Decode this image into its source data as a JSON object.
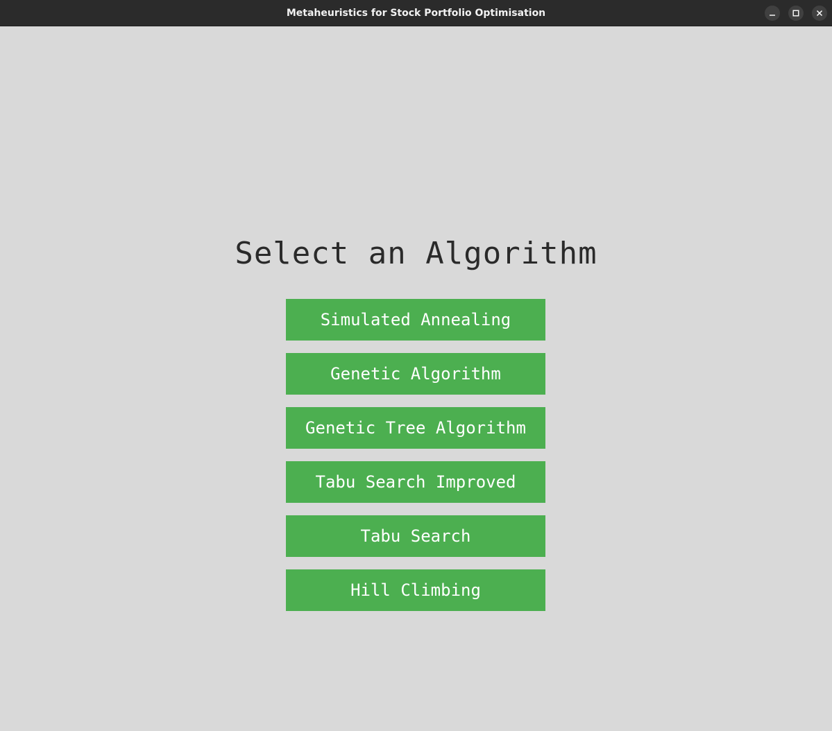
{
  "window": {
    "title": "Metaheuristics for Stock Portfolio Optimisation",
    "controls": [
      "minimize-icon",
      "maximize-icon",
      "close-icon"
    ]
  },
  "main": {
    "heading": "Select an Algorithm",
    "algorithms": [
      {
        "label": "Simulated Annealing"
      },
      {
        "label": "Genetic Algorithm"
      },
      {
        "label": "Genetic Tree Algorithm"
      },
      {
        "label": "Tabu Search Improved"
      },
      {
        "label": "Tabu Search"
      },
      {
        "label": "Hill Climbing"
      }
    ]
  },
  "colors": {
    "background": "#d9d9d9",
    "titlebar": "#2b2b2b",
    "button": "#4caf50",
    "button_text": "#ffffff",
    "heading_text": "#2a2a2a"
  }
}
